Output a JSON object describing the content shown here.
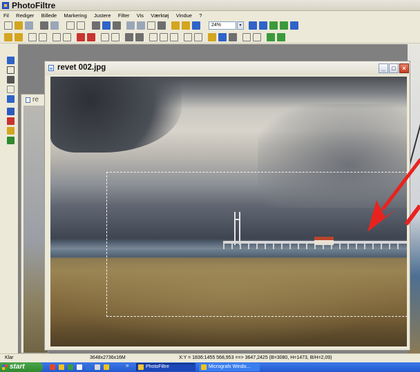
{
  "app": {
    "title": "PhotoFiltre"
  },
  "menu": [
    "Fil",
    "Rediger",
    "Billede",
    "Markering",
    "Justere",
    "Filter",
    "Vis",
    "Værktøj",
    "Vindue",
    "?"
  ],
  "toolbar": {
    "zoom_value": "24%"
  },
  "background_window": {
    "title_partial": "re"
  },
  "document": {
    "title": "revet 002.jpg",
    "minimize_label": "_",
    "maximize_label": "□",
    "close_label": "×"
  },
  "status": {
    "state": "Klar",
    "image_info": "3648x2736x16M",
    "coords": "X:Y = 1836:1455   568,953 ==> 3647,2425 (B=3080, H=1473, B/H=2,09)"
  },
  "taskbar": {
    "start_label": "start",
    "chevron": "»",
    "tasks": [
      {
        "label": "PhotoFiltre",
        "active": true
      },
      {
        "label": "Micrografx Windo...",
        "active": false
      }
    ]
  },
  "colors": {
    "annotation_arrow": "#e8231f",
    "selection_marquee": "#f2f2f2",
    "taskbar": "#235ad0",
    "start_button": "#2f8a2f"
  },
  "icons": {
    "toolbar": [
      "new-icon",
      "open-icon",
      "save-icon",
      "print-icon",
      "scan-icon",
      "undo-icon",
      "redo-icon",
      "text-icon",
      "color-icon",
      "zoom-in-icon",
      "zoom-out-icon",
      "fullscreen-icon"
    ],
    "palette": [
      "selection-icon",
      "lasso-icon",
      "frame-icon",
      "exif-icon",
      "brush-icon",
      "pyramid-icon",
      "eyedropper-icon",
      "clipboard-icon",
      "screen-icon"
    ]
  }
}
